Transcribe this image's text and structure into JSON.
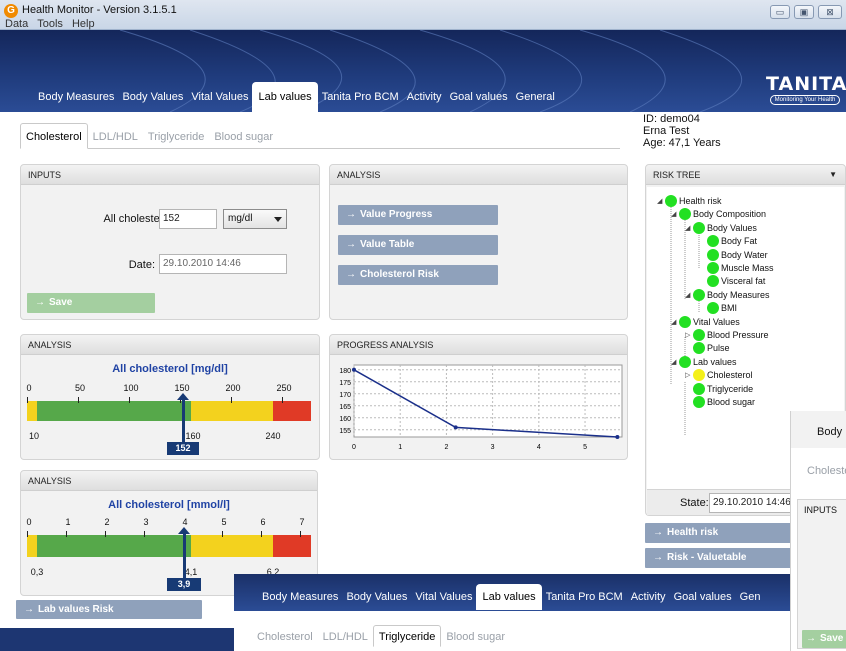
{
  "window": {
    "title": "Health Monitor - Version 3.1.5.1",
    "menu": [
      "Data",
      "Tools",
      "Help"
    ],
    "buttons": [
      "▭",
      "▣",
      "⊠"
    ]
  },
  "brand": {
    "name": "TANITA",
    "tagline": "Monitoring Your Health"
  },
  "nav_tabs": [
    {
      "label": "Body Measures"
    },
    {
      "label": "Body Values"
    },
    {
      "label": "Vital Values"
    },
    {
      "label": "Lab values",
      "active": true
    },
    {
      "label": "Tanita Pro BCM"
    },
    {
      "label": "Activity"
    },
    {
      "label": "Goal values"
    },
    {
      "label": "General"
    }
  ],
  "sub_tabs": [
    {
      "label": "Cholesterol",
      "active": true
    },
    {
      "label": "LDL/HDL"
    },
    {
      "label": "Triglyceride"
    },
    {
      "label": "Blood sugar"
    }
  ],
  "user": {
    "id": "ID: demo04",
    "name": "Erna Test",
    "age": "Age: 47,1 Years"
  },
  "inputs_panel": {
    "title": "INPUTS",
    "cholesterol_label": "All cholesterol:",
    "cholesterol_value": "152",
    "unit": "mg/dl",
    "date_label": "Date:",
    "date_value": "29.10.2010 14:46",
    "save_label": "Save"
  },
  "analysis_buttons_panel": {
    "title": "ANALYSIS",
    "buttons": [
      "Value Progress",
      "Value Table",
      "Cholesterol Risk"
    ]
  },
  "gauge_mg": {
    "panel_title": "ANALYSIS",
    "title": "All cholesterol [mg/dl]",
    "ticks": [
      "0",
      "50",
      "100",
      "150",
      "200",
      "250"
    ],
    "low_label": "10",
    "mid_label": "160",
    "high_label": "240",
    "value": "152",
    "colors": {
      "yellow": "#f3d21e",
      "green": "#56a84a",
      "red": "#e03a26"
    }
  },
  "gauge_mmol": {
    "panel_title": "ANALYSIS",
    "title": "All cholesterol [mmol/l]",
    "ticks": [
      "0",
      "1",
      "2",
      "3",
      "4",
      "5",
      "6",
      "7"
    ],
    "low_label": "0,3",
    "mid_label": "4,1",
    "high_label": "6,2",
    "value": "3,9"
  },
  "lab_risk_button": "Lab values Risk",
  "progress_panel": {
    "title": "PROGRESS ANALYSIS"
  },
  "chart_data": {
    "type": "line",
    "title": "",
    "xlabel": "",
    "ylabel": "",
    "x": [
      0,
      2.2,
      5.7
    ],
    "y": [
      180,
      156,
      152
    ],
    "xlim": [
      0,
      5.8
    ],
    "ylim": [
      152,
      182
    ],
    "xticks": [
      "0",
      "1",
      "2",
      "3",
      "4",
      "5"
    ],
    "yticks": [
      "180",
      "175",
      "170",
      "165",
      "160",
      "155"
    ],
    "grid": true,
    "color": "#1a2f8a"
  },
  "risk_tree": {
    "title": "RISK TREE",
    "items": [
      {
        "label": "Health risk",
        "level": 0,
        "color": "#22e022",
        "expander": "◢"
      },
      {
        "label": "Body Composition",
        "level": 1,
        "color": "#22e022",
        "expander": "◢"
      },
      {
        "label": "Body Values",
        "level": 2,
        "color": "#22e022",
        "expander": "◢"
      },
      {
        "label": "Body Fat",
        "level": 3,
        "color": "#22e022",
        "expander": ""
      },
      {
        "label": "Body Water",
        "level": 3,
        "color": "#22e022",
        "expander": ""
      },
      {
        "label": "Muscle Mass",
        "level": 3,
        "color": "#22e022",
        "expander": ""
      },
      {
        "label": "Visceral fat",
        "level": 3,
        "color": "#22e022",
        "expander": ""
      },
      {
        "label": "Body Measures",
        "level": 2,
        "color": "#22e022",
        "expander": "◢"
      },
      {
        "label": "BMI",
        "level": 3,
        "color": "#22e022",
        "expander": ""
      },
      {
        "label": "Vital Values",
        "level": 1,
        "color": "#22e022",
        "expander": "◢"
      },
      {
        "label": "Blood Pressure",
        "level": 2,
        "color": "#22e022",
        "expander": "▷"
      },
      {
        "label": "Pulse",
        "level": 2,
        "color": "#22e022",
        "expander": ""
      },
      {
        "label": "Lab values",
        "level": 1,
        "color": "#22e022",
        "expander": "◢"
      },
      {
        "label": "Cholesterol",
        "level": 2,
        "color": "#f4f01a",
        "expander": "▷"
      },
      {
        "label": "Triglyceride",
        "level": 2,
        "color": "#22e022",
        "expander": ""
      },
      {
        "label": "Blood sugar",
        "level": 2,
        "color": "#22e022",
        "expander": ""
      }
    ],
    "state_label": "State:",
    "state_value": "29.10.2010 14:46"
  },
  "side_buttons": [
    "Health risk",
    "Risk - Valuetable"
  ],
  "overlay_bottom": {
    "nav_tabs": [
      "Body Measures",
      "Body Values",
      "Vital Values",
      "Lab values",
      "Tanita Pro BCM",
      "Activity",
      "Goal values",
      "Gen"
    ],
    "sub_tabs": [
      "Cholesterol",
      "LDL/HDL",
      "Triglyceride",
      "Blood sugar"
    ]
  },
  "overlay_right": {
    "tab": "Body M",
    "sub_tab": "Cholester",
    "inputs_title": "INPUTS",
    "save_label": "Save"
  }
}
